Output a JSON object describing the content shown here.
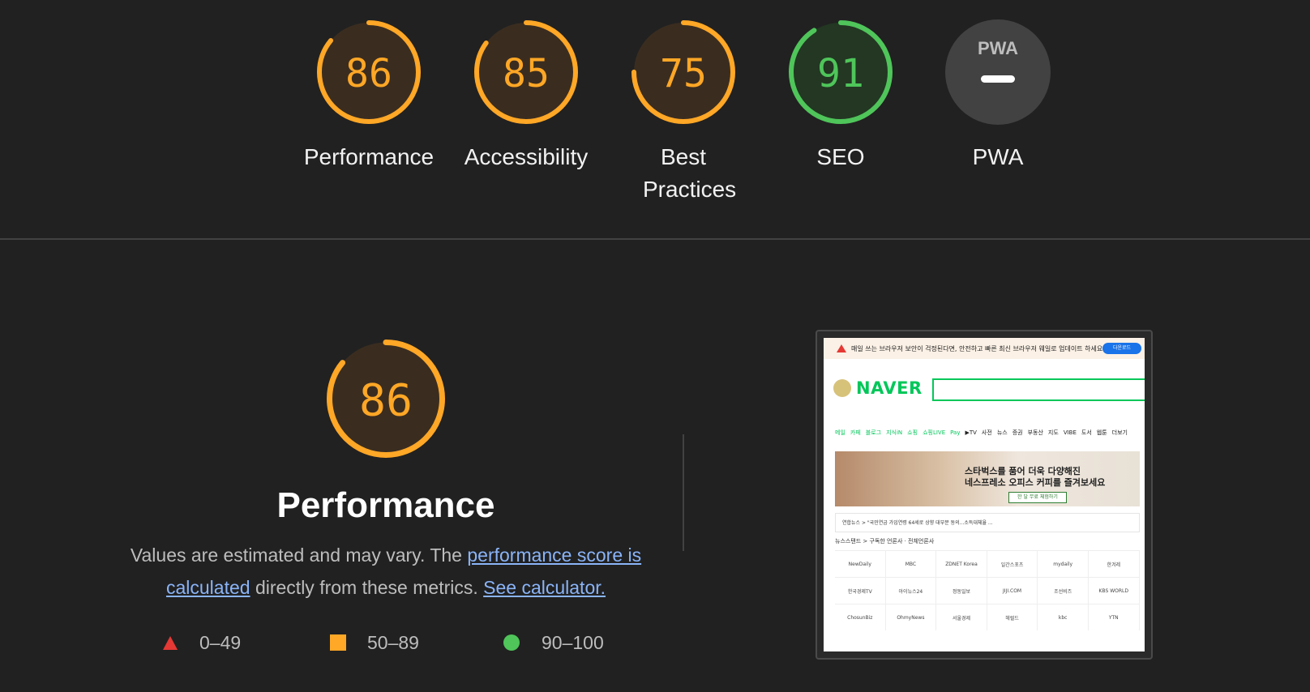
{
  "colors": {
    "background": "#212121",
    "average": "#ffa726",
    "average_fill": "#3a2d20",
    "pass": "#4fc55a",
    "pass_fill": "#233723",
    "fail": "#e53935",
    "na_fill": "#424242",
    "link": "#8ab4f8"
  },
  "gauges": [
    {
      "label": "Performance",
      "score": "86",
      "value": 86,
      "rating": "average"
    },
    {
      "label": "Accessibility",
      "score": "85",
      "value": 85,
      "rating": "average"
    },
    {
      "label": "Best Practices",
      "score": "75",
      "value": 75,
      "rating": "average"
    },
    {
      "label": "SEO",
      "score": "91",
      "value": 91,
      "rating": "pass"
    },
    {
      "label": "PWA",
      "score": "PWA",
      "value": null,
      "rating": "na"
    }
  ],
  "performance": {
    "score": "86",
    "value": 86,
    "title": "Performance",
    "desc_prefix": "Values are estimated and may vary. The ",
    "link1": "performance score is calculated",
    "desc_middle": " directly from these metrics. ",
    "link2": "See calculator."
  },
  "legend": [
    {
      "icon": "triangle-icon",
      "range": "0–49"
    },
    {
      "icon": "square-icon",
      "range": "50–89"
    },
    {
      "icon": "circle-icon",
      "range": "90–100"
    }
  ],
  "screenshot": {
    "warning": "매일 쓰는 브라우저 보안이 걱정된다면, 안전하고 빠른 최신 브라우저 웨일로 업데이트 하세요.",
    "warning_btn": "다운로드",
    "logo": "NAVER",
    "menu": [
      "메일",
      "카페",
      "블로그",
      "지식iN",
      "쇼핑",
      "쇼핑LIVE",
      "Pay",
      "▶TV",
      "사전",
      "뉴스",
      "증권",
      "부동산",
      "지도",
      "VIBE",
      "도서",
      "웹툰",
      "더보기"
    ],
    "banner_line1": "스타벅스를 품어 더욱 다양해진",
    "banner_line2": "네스프레소 오피스 커피를 즐겨보세요",
    "banner_btn": "한 달 무료 체험하기",
    "news_bar": "연합뉴스 > \"국민연금 가입연령 64세로 상향 대부분 동의...소득대체율 ...",
    "news_stand": "뉴스스탠드 > 구독한 언론사 · 전체언론사",
    "outlets": [
      [
        "NewDaily",
        "MBC",
        "ZDNET Korea",
        "일간스포츠",
        "mydaily",
        "한겨레"
      ],
      [
        "한국경제TV",
        "아이뉴스24",
        "정동일보",
        "JIJI.COM",
        "조선비즈",
        "KBS WORLD"
      ],
      [
        "ChosunBiz",
        "OhmyNews",
        "서울경제",
        "헤럴드",
        "kbc",
        "YTN"
      ]
    ]
  }
}
